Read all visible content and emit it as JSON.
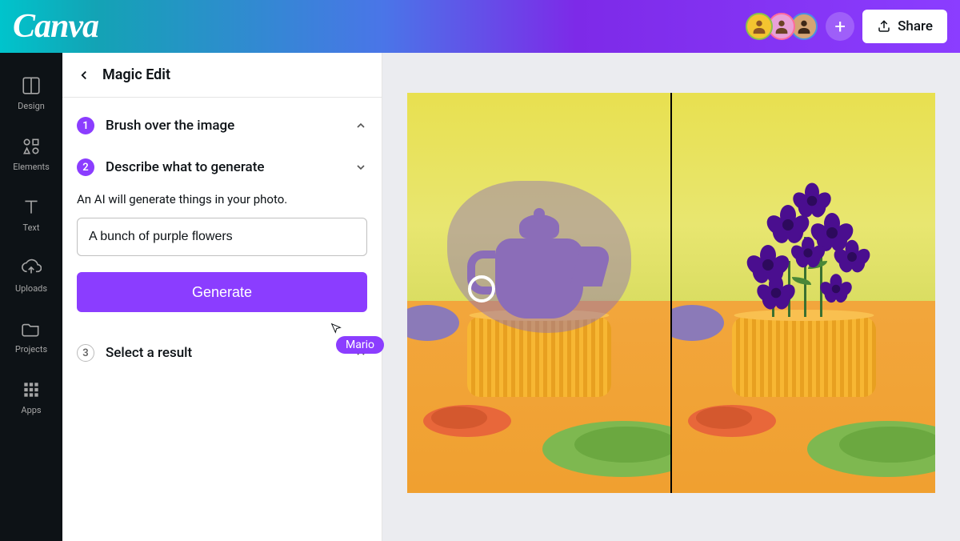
{
  "header": {
    "logo": "Canva",
    "share_label": "Share"
  },
  "rail": {
    "items": [
      {
        "label": "Design"
      },
      {
        "label": "Elements"
      },
      {
        "label": "Text"
      },
      {
        "label": "Uploads"
      },
      {
        "label": "Projects"
      },
      {
        "label": "Apps"
      }
    ]
  },
  "panel": {
    "title": "Magic Edit",
    "step1": {
      "num": "1",
      "title": "Brush over the image"
    },
    "step2": {
      "num": "2",
      "title": "Describe what to generate",
      "desc": "An AI will generate things in your photo.",
      "prompt_value": "A bunch of purple flowers",
      "generate_label": "Generate"
    },
    "step3": {
      "num": "3",
      "title": "Select a result"
    }
  },
  "cursor": {
    "user": "Mario"
  }
}
